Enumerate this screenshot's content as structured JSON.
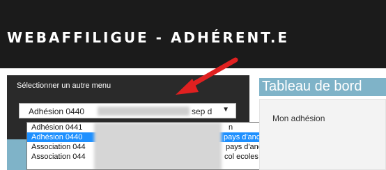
{
  "header": {
    "brand": "WEBAFFILIGUE - ADHÉRENT.E",
    "bg": "#1b1b1b"
  },
  "menu": {
    "title": "Sélectionner un autre menu",
    "selected_value": "Adhésion 0440",
    "selected_value_tail": "sep d",
    "options": [
      {
        "prefix": "Adhésion 0441",
        "suffix": "n",
        "selected": false
      },
      {
        "prefix": "Adhésion 0440",
        "suffix": "pays d'ancenis",
        "selected": true
      },
      {
        "prefix": "Association 044",
        "suffix": "pays d'ancenis",
        "selected": false
      },
      {
        "prefix": "Association 044",
        "suffix": "col ecoles publiques ancenis",
        "selected": false
      }
    ]
  },
  "main": {
    "title": "Tableau de bord",
    "card_label": "Mon adhésion"
  },
  "colors": {
    "accent": "#7fb3c8",
    "selected": "#1e90ff",
    "arrow": "#e02020"
  }
}
